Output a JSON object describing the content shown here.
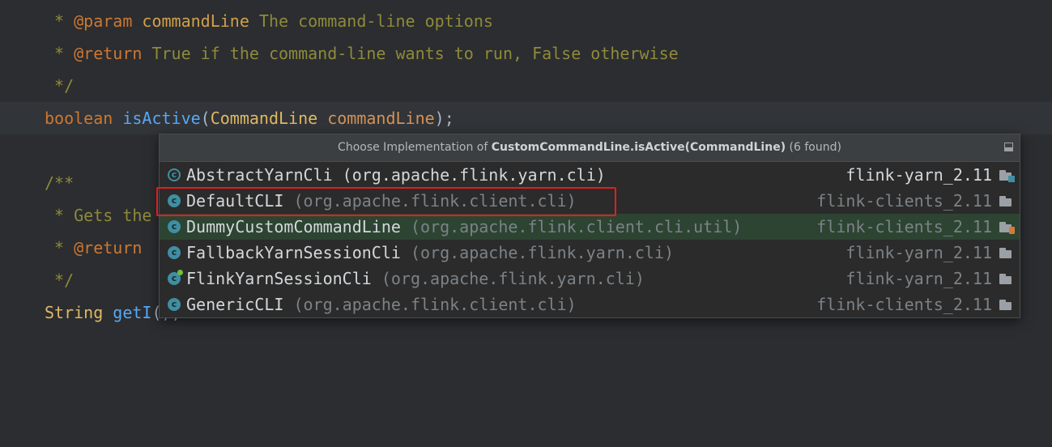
{
  "editor": {
    "lines": [
      {
        "parts": [
          " * ",
          "@param",
          " ",
          "commandLine",
          " The command-line options"
        ]
      },
      {
        "parts": [
          " * ",
          "@return",
          " True if the command-line wants to run, False otherwise"
        ]
      },
      {
        "parts": [
          " */"
        ]
      },
      {
        "parts": [
          "boolean",
          " ",
          "isActive",
          "(",
          "CommandLine",
          " ",
          "commandLine",
          ");"
        ]
      },
      {
        "parts": [
          ""
        ]
      },
      {
        "parts": [
          "/**"
        ]
      },
      {
        "parts": [
          " * Gets the"
        ]
      },
      {
        "parts": [
          " * ",
          "@return"
        ]
      },
      {
        "parts": [
          " */"
        ]
      },
      {
        "parts": [
          "String",
          " ",
          "getI",
          "();"
        ]
      }
    ]
  },
  "popup": {
    "header_prefix": "Choose Implementation of ",
    "header_target": "CustomCommandLine.isActive(CommandLine)",
    "header_suffix": " (6 found)",
    "items": [
      {
        "name": "AbstractYarnCli",
        "package": " (org.apache.flink.yarn.cli)",
        "module": "flink-yarn_2.11",
        "icon": "abstract-class-icon"
      },
      {
        "name": "DefaultCLI",
        "package": " (org.apache.flink.client.cli)",
        "module": "flink-clients_2.11",
        "icon": "class-icon"
      },
      {
        "name": "DummyCustomCommandLine",
        "package": " (org.apache.flink.client.cli.util)",
        "module": "flink-clients_2.11",
        "icon": "class-icon"
      },
      {
        "name": "FallbackYarnSessionCli",
        "package": " (org.apache.flink.yarn.cli)",
        "module": "flink-yarn_2.11",
        "icon": "class-icon"
      },
      {
        "name": "FlinkYarnSessionCli",
        "package": " (org.apache.flink.yarn.cli)",
        "module": "flink-yarn_2.11",
        "icon": "runnable-class-icon"
      },
      {
        "name": "GenericCLI",
        "package": " (org.apache.flink.client.cli)",
        "module": "flink-clients_2.11",
        "icon": "class-icon"
      }
    ]
  },
  "colors": {
    "background": "#2b2d30",
    "selection": "#2d4432",
    "highlight_box": "#e01f1f"
  }
}
